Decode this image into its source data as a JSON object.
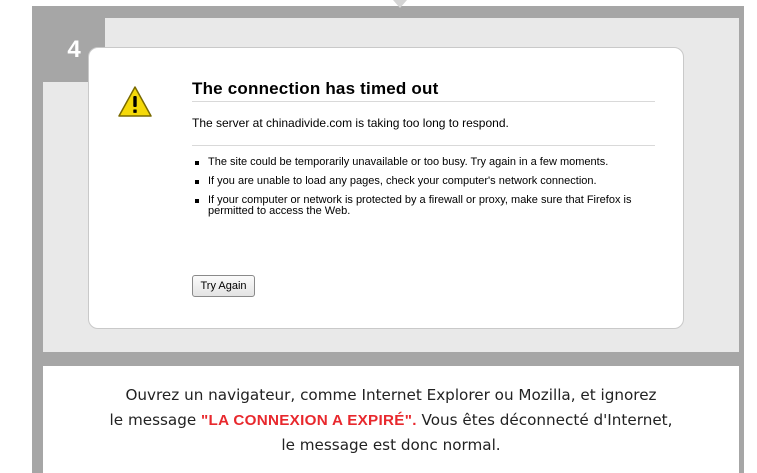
{
  "step": {
    "number": "4"
  },
  "error_page": {
    "title": "The connection has timed out",
    "description": "The server at chinadivide.com is taking too long to respond.",
    "tips": [
      "The site could be temporarily unavailable or too busy. Try again in a few moments.",
      "If you are unable to load any pages, check your computer's network connection.",
      "If your computer or network is protected by a firewall or proxy, make sure that Firefox is permitted to access the Web."
    ],
    "try_again_label": "Try Again",
    "icon": "warning-icon"
  },
  "caption": {
    "line1": "Ouvrez un navigateur, comme Internet Explorer ou Mozilla, et ignorez",
    "line2_before": "le message ",
    "line2_highlight": "\"LA CONNEXION A EXPIRÉ\".",
    "line2_after": " Vous êtes déconnecté d'Internet,",
    "line3": "le message est donc normal."
  },
  "colors": {
    "frame": "#a6a6a6",
    "highlight": "#e8282d",
    "warning_fill": "#f5d90a"
  }
}
